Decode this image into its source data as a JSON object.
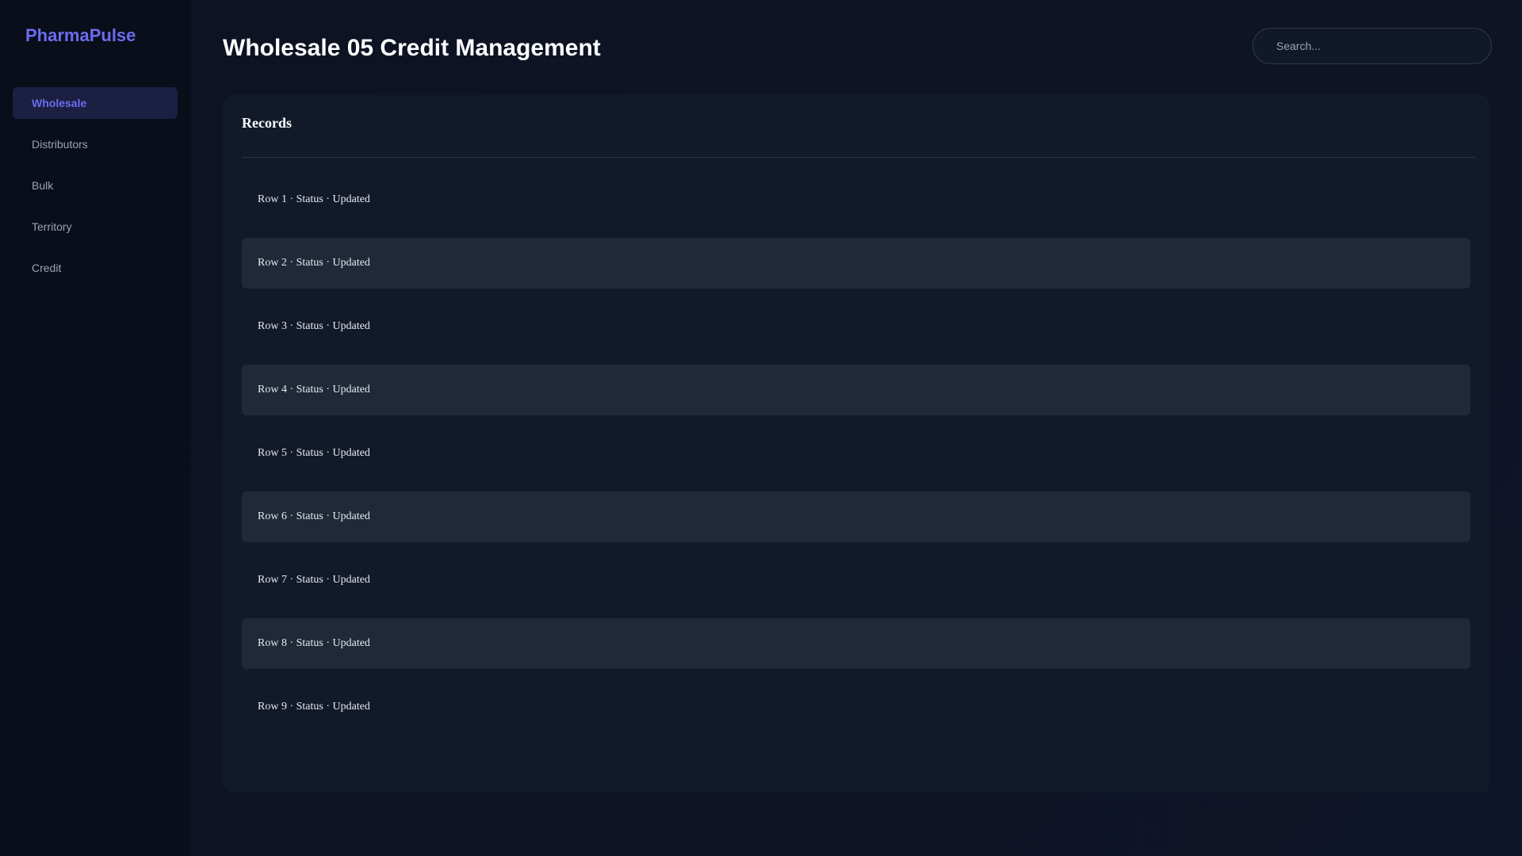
{
  "sidebar": {
    "brand": "PharmaPulse",
    "items": [
      {
        "label": "Wholesale",
        "active": true
      },
      {
        "label": "Distributors",
        "active": false
      },
      {
        "label": "Bulk",
        "active": false
      },
      {
        "label": "Territory",
        "active": false
      },
      {
        "label": "Credit",
        "active": false
      }
    ]
  },
  "header": {
    "title": "Wholesale 05 Credit Management",
    "search_placeholder": "Search..."
  },
  "records": {
    "title": "Records",
    "rows": [
      "Row 1 · Status · Updated",
      "Row 2 · Status · Updated",
      "Row 3 · Status · Updated",
      "Row 4 · Status · Updated",
      "Row 5 · Status · Updated",
      "Row 6 · Status · Updated",
      "Row 7 · Status · Updated",
      "Row 8 · Status · Updated",
      "Row 9 · Status · Updated"
    ]
  },
  "colors": {
    "accent": "#6b6cf0",
    "sidebar_bg": "#0a0e1a",
    "card_bg": "#121a2a",
    "row_alt_bg": "#1f2938"
  }
}
